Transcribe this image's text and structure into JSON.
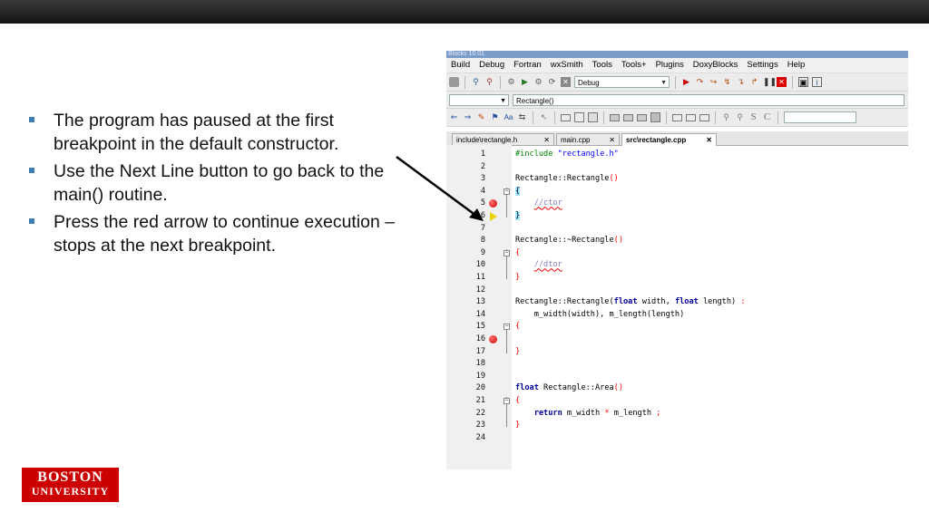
{
  "bullets": [
    "The program has paused at the first breakpoint in the default constructor.",
    "Use the Next Line button to go back to the main() routine.",
    "Press the red arrow to continue execution – stops at the next breakpoint."
  ],
  "logo": {
    "line1": "BOSTON",
    "line2": "UNIVERSITY",
    "color": "#cc0000"
  },
  "ide": {
    "window_title": "Blocks 10.01",
    "menu": [
      "Build",
      "Debug",
      "Fortran",
      "wxSmith",
      "Tools",
      "Tools+",
      "Plugins",
      "DoxyBlocks",
      "Settings",
      "Help"
    ],
    "build_target": "Debug",
    "function_scope": "Rectangle()",
    "tabs": [
      {
        "label": "include\\rectangle.h",
        "close": "✕"
      },
      {
        "label": "main.cpp",
        "close": "✕"
      },
      {
        "label": "src\\rectangle.cpp",
        "close": "✕"
      }
    ],
    "active_tab": "src\\rectangle.cpp",
    "line_numbers": [
      "1",
      "2",
      "3",
      "4",
      "5",
      "6",
      "7",
      "8",
      "9",
      "10",
      "11",
      "12",
      "13",
      "14",
      "15",
      "16",
      "17",
      "18",
      "19",
      "20",
      "21",
      "22",
      "23",
      "24"
    ],
    "breakpoint_lines": [
      5,
      16
    ],
    "current_line": 6,
    "accent_color": "#cc0000",
    "code": {
      "l1_directive": "#include",
      "l1_file": "\"rectangle.h\"",
      "l3_class": "Rectangle::Rectangle",
      "l3_parens": "()",
      "l4": "{",
      "l5_comment": "//ctor",
      "l6": "}",
      "l8_class": "Rectangle::~Rectangle",
      "l8_parens": "()",
      "l9": "{",
      "l10_comment": "//dtor",
      "l11": "}",
      "l13_name": "Rectangle::Rectangle(",
      "l13_type1": "float",
      "l13_arg1": " width, ",
      "l13_type2": "float",
      "l13_arg2": " length) ",
      "l13_colon": ":",
      "l14_init": "    m_width(width), m_length(length)",
      "l15": "{",
      "l17": "}",
      "l20_type": "float",
      "l20_name": " Rectangle::Area",
      "l20_parens": "()",
      "l21": "{",
      "l22_kw": "    return",
      "l22_expr1": " m_width ",
      "l22_op": "*",
      "l22_expr2": " m_length ",
      "l22_semi": ";",
      "l23": "}"
    }
  }
}
